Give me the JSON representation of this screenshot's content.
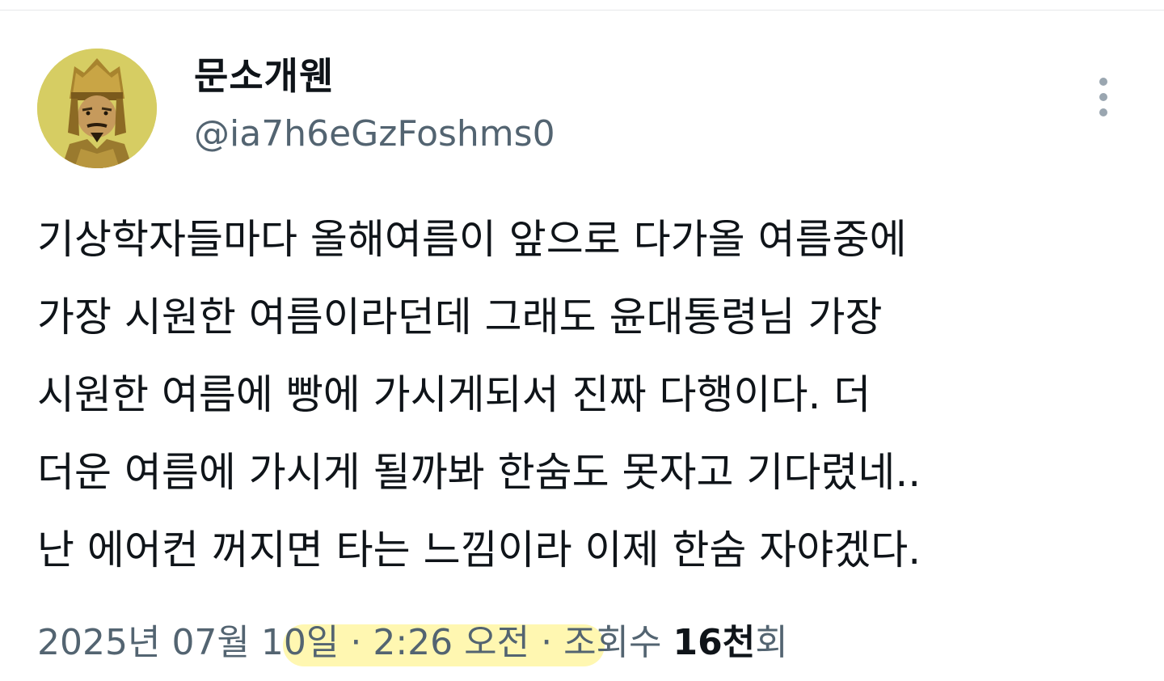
{
  "author": {
    "display_name": "문소개웬",
    "handle": "@ia7h6eGzFoshms0"
  },
  "menu": {
    "icon": "more-vertical-icon"
  },
  "tweet": {
    "text": "기상학자들마다 올해여름이 앞으로 다가올 여름중에\n가장 시원한 여름이라던데 그래도 윤대통령님 가장\n시원한 여름에 빵에 가시게되서 진짜 다행이다. 더\n더운 여름에 가시게 될까봐 한숨도 못자고 기다렸네..\n난 에어컨 꺼지면 타는 느낌이라 이제 한숨 자야겠다."
  },
  "meta": {
    "date": "2025년 07월 10일",
    "separator1": " · ",
    "time": "2:26 오전",
    "separator2": " · ",
    "views_label": "조회수 ",
    "views_count": "16천",
    "views_suffix": "회"
  },
  "colors": {
    "text_primary": "#0f1419",
    "text_secondary": "#536471",
    "highlight": "#fff6a8"
  }
}
